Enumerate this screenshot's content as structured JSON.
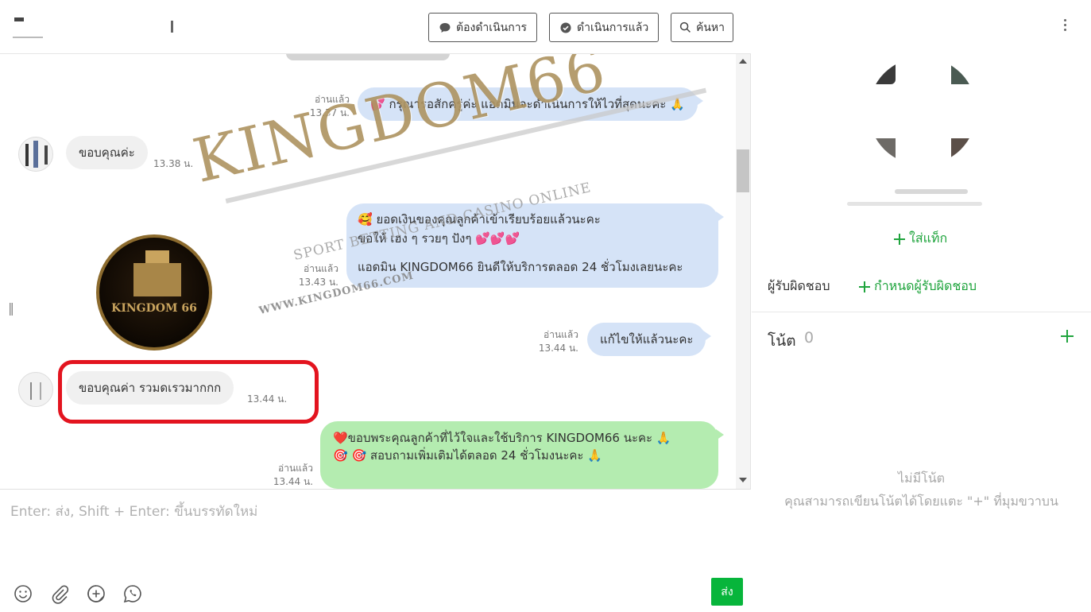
{
  "header": {
    "btn_pending": "ต้องดำเนินการ",
    "btn_done": "ดำเนินการแล้ว",
    "btn_search": "ค้นหา"
  },
  "messages": [
    {
      "read": "อ่านแล้ว",
      "time": "13.37 น.",
      "text": "💕 กรุณารอสักครู่ค่ะ แอดมินจะดำเนินการให้ไวที่สุดนะคะ 🙏"
    },
    {
      "text": "ขอบคุณค่ะ",
      "time": "13.38 น."
    },
    {
      "read": "อ่านแล้ว",
      "time": "13.43 น.",
      "line1": "🥰 ยอดเงินของคุณลูกค้าเข้าเรียบร้อยแล้วนะคะ",
      "line2": "ขอให้ เฮง ๆ รวยๆ ปังๆ 💕💕💕",
      "line3": "แอดมิน KINGDOM66 ยินดีให้บริการตลอด 24 ชั่วโมงเลยนะคะ"
    },
    {
      "read": "อ่านแล้ว",
      "time": "13.44 น.",
      "text": "แก้ไขให้แล้วนะคะ"
    },
    {
      "text": "ขอบคุณค่า รวมดเรวมากกก",
      "time": "13.44 น."
    },
    {
      "read": "อ่านแล้ว",
      "time": "13.44 น.",
      "line1": "❤️ขอบพระคุณลูกค้าที่ไว้ใจและใช้บริการ   KINGDOM66  นะคะ 🙏",
      "line2": "🎯 🎯 สอบถามเพิ่มเติมได้ตลอด 24 ชั่วโมงนะคะ 🙏"
    }
  ],
  "watermark": {
    "brand": "KINGDOM66",
    "tagline": "SPORT BETTING AND CASINO ONLINE",
    "url": "WWW.KINGDOM66.COM",
    "coin_text": "KINGDOM 66"
  },
  "composer": {
    "placeholder": "Enter: ส่ง, Shift + Enter: ขึ้นบรรทัดใหม่",
    "send": "ส่ง"
  },
  "sidebar": {
    "add_tag": "ใส่แท็ก",
    "assignee_label": "ผู้รับผิดชอบ",
    "assignee_add": "กำหนดผู้รับผิดชอบ",
    "notes_title": "โน้ต",
    "notes_count": "0",
    "empty_title": "ไม่มีโน้ต",
    "empty_sub": "คุณสามารถเขียนโน้ตได้โดยแตะ \"+\" ที่มุมขวาบน"
  },
  "colors": {
    "accent_green": "#07b53b",
    "link_green": "#1fa43d",
    "bubble_blue": "#d5e3f7",
    "bubble_green": "#b4ecb0",
    "highlight_red": "#e3141f"
  }
}
